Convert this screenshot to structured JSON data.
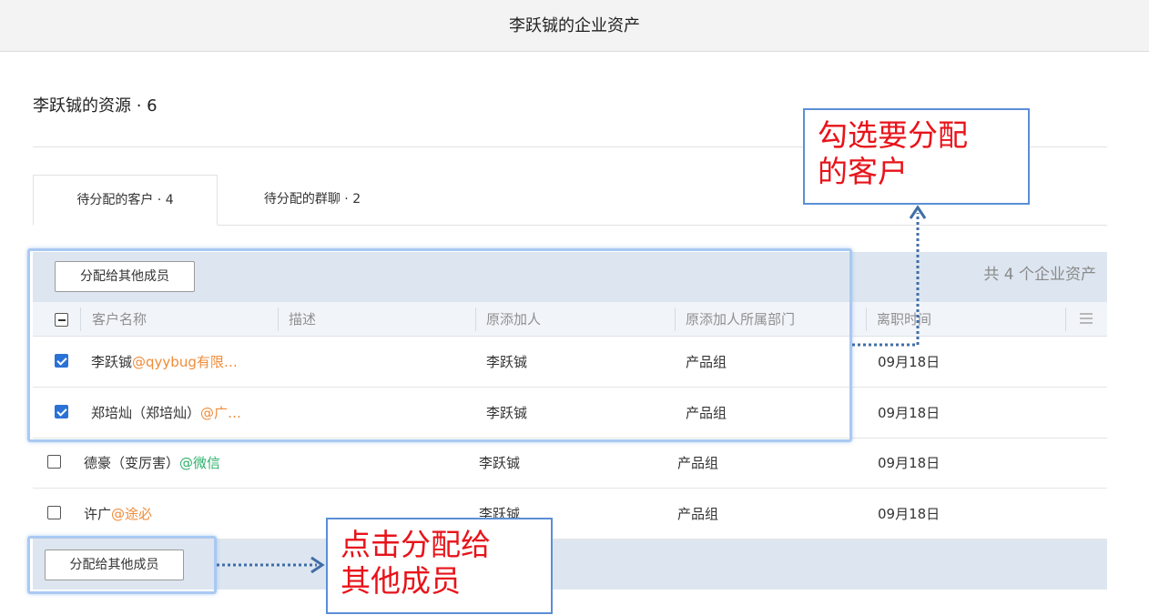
{
  "header": {
    "title": "李跃铖的企业资产"
  },
  "resources": {
    "title": "李跃铖的资源 · 6"
  },
  "tabs": [
    {
      "label": "待分配的客户 · 4"
    },
    {
      "label": "待分配的群聊 · 2"
    }
  ],
  "toolbar": {
    "assign_label": "分配给其他成员",
    "count_label": "共 4 个企业资产"
  },
  "table": {
    "columns": [
      "客户名称",
      "描述",
      "原添加人",
      "原添加人所属部门",
      "离职时间"
    ],
    "rows": [
      {
        "checked": true,
        "name": "李跃铖",
        "tag": "@qyybug有限…",
        "tag_color": "#f08c3a",
        "adder": "李跃铖",
        "dept": "产品组",
        "date": "09月18日"
      },
      {
        "checked": true,
        "name": "郑培灿（郑培灿）",
        "tag": "@广…",
        "tag_color": "#f08c3a",
        "adder": "李跃铖",
        "dept": "产品组",
        "date": "09月18日"
      },
      {
        "checked": false,
        "name": "德豪（变厉害）",
        "tag": "@微信",
        "tag_color": "#2fb16b",
        "adder": "李跃铖",
        "dept": "产品组",
        "date": "09月18日"
      },
      {
        "checked": false,
        "name": "许广",
        "tag": "@途必",
        "tag_color": "#f08c3a",
        "adder": "李跃铖",
        "dept": "产品组",
        "date": "09月18日"
      }
    ]
  },
  "bottom": {
    "assign_label": "分配给其他成员"
  },
  "annotations": {
    "select": "勾选要分配\n的客户",
    "assign": "点击分配给\n其他成员"
  },
  "colors": {
    "accent": "#2a72d6",
    "toolbar_bg": "#dde6f0",
    "annotation_text": "#e8131a",
    "annotation_border": "#5b8fd6"
  }
}
